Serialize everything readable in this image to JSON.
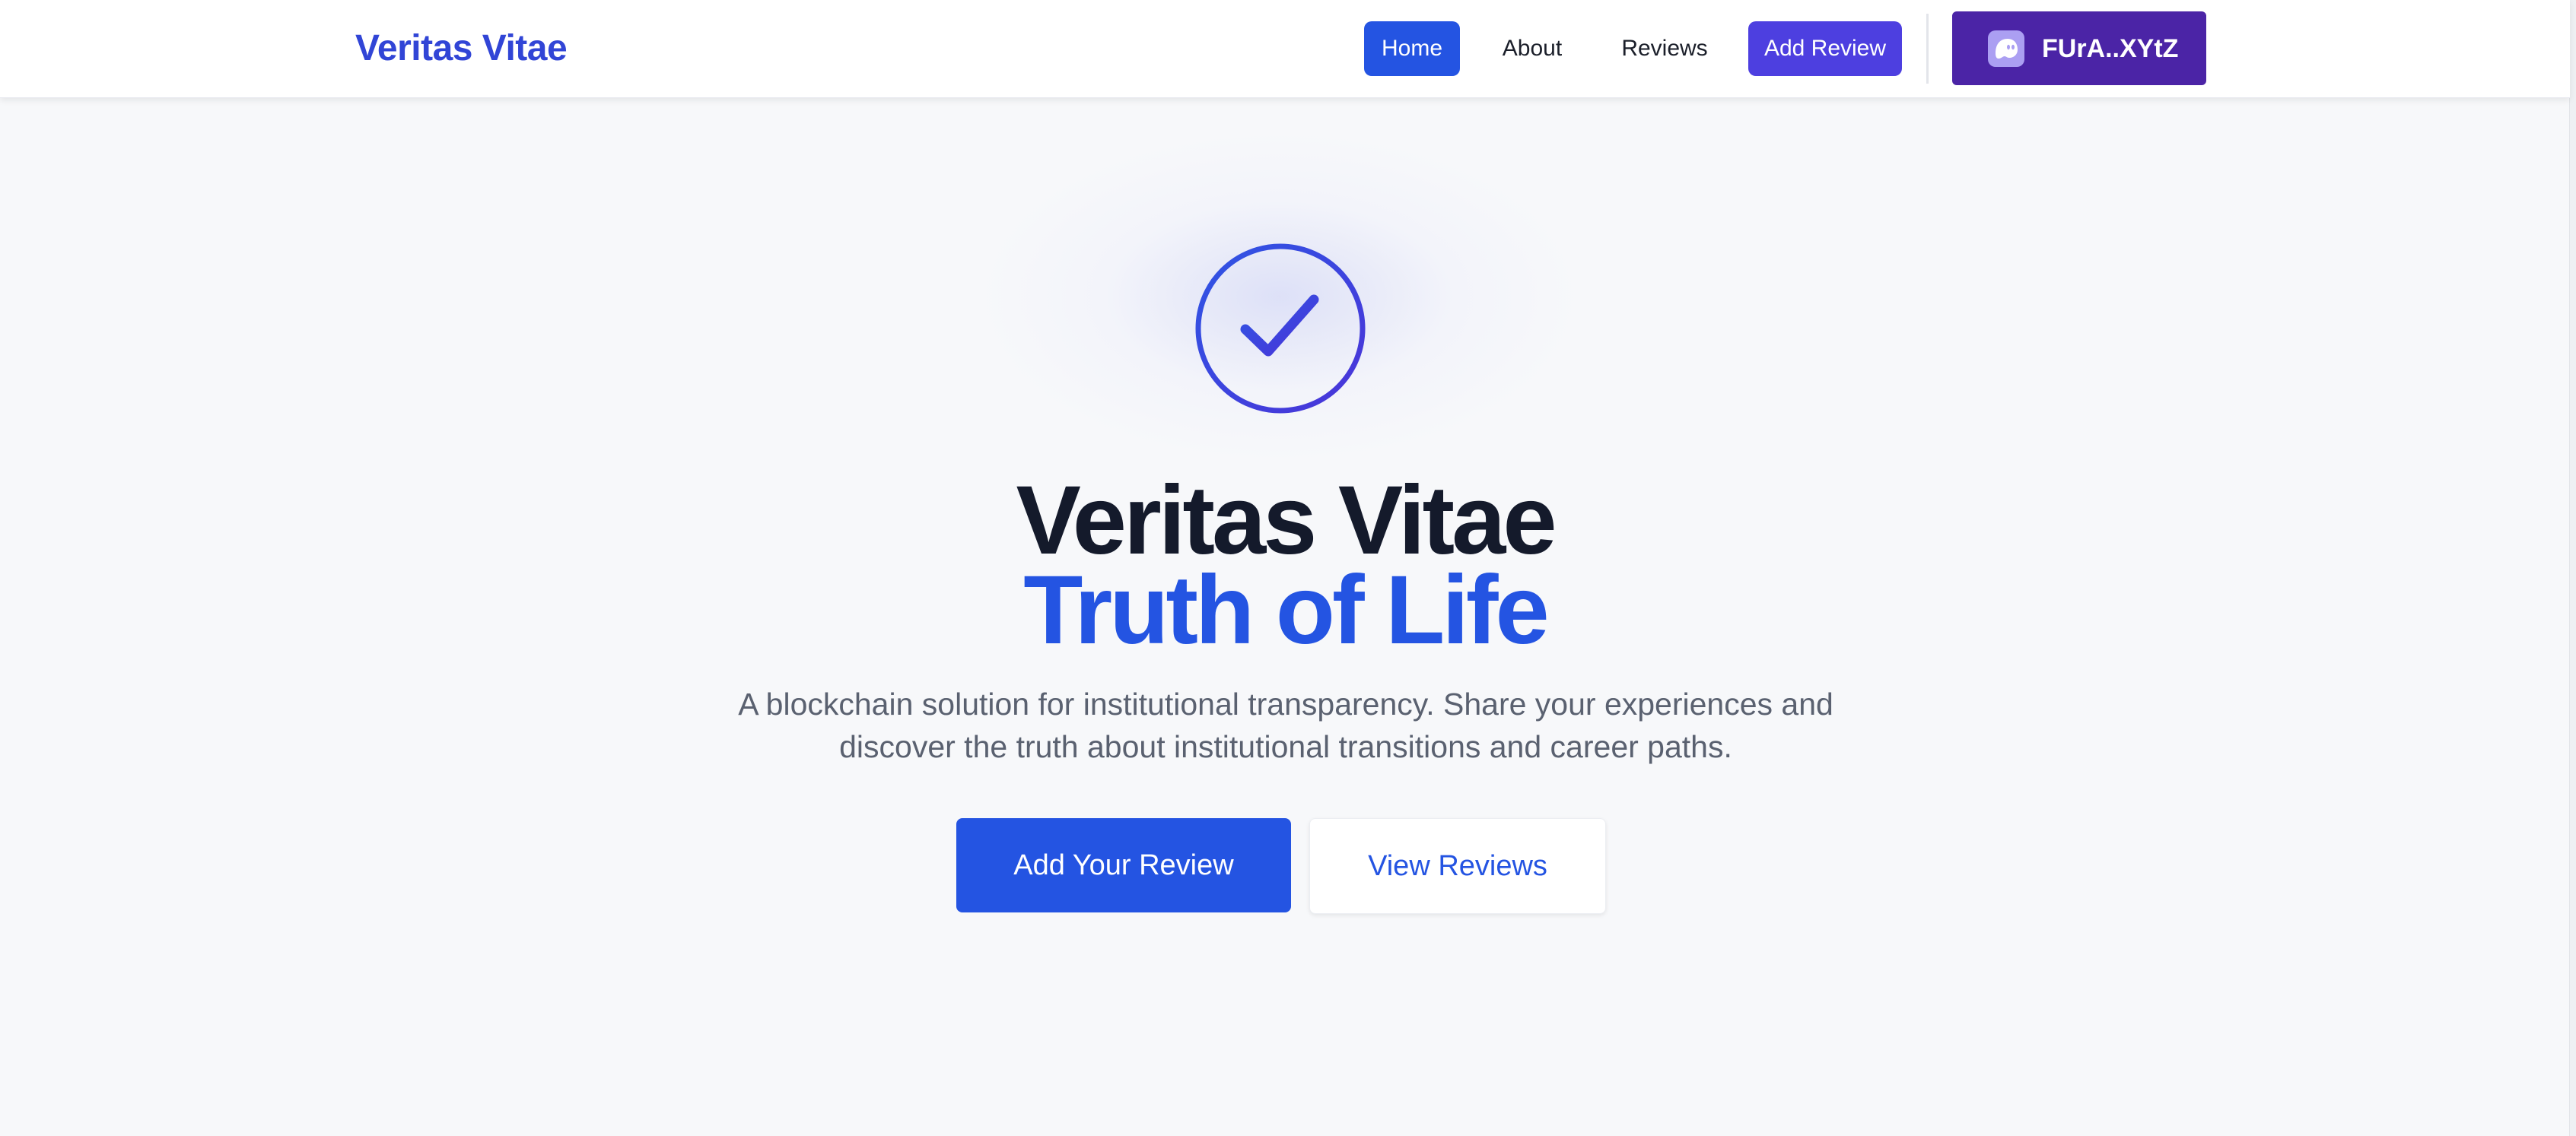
{
  "header": {
    "brand": "Veritas Vitae",
    "nav": {
      "home": "Home",
      "about": "About",
      "reviews": "Reviews",
      "add_review": "Add Review"
    },
    "wallet": {
      "label": "FUrA..XYtZ",
      "icon": "phantom-ghost-icon"
    }
  },
  "hero": {
    "icon": "check-circle-icon",
    "title": "Veritas Vitae",
    "subtitle": "Truth of Life",
    "description": "A blockchain solution for institutional transparency. Share your experiences and discover the truth about institutional transitions and career paths.",
    "primary_cta": "Add Your Review",
    "secondary_cta": "View Reviews"
  },
  "colors": {
    "accent": "#2454e2",
    "accent_secondary": "#4d3fe0",
    "wallet": "#4b24a6",
    "heading": "#141a2b",
    "background": "#f7f8fa"
  }
}
